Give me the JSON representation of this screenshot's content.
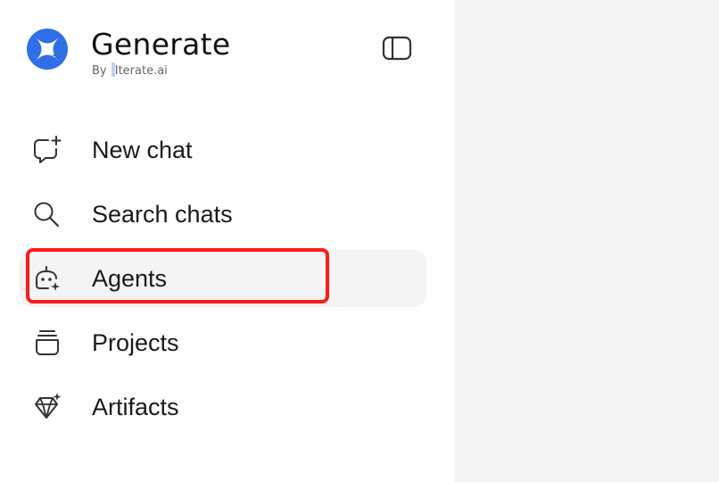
{
  "brand": {
    "title": "Generate",
    "subtitle_prefix": "By ",
    "subtitle_name": "Iterate.ai",
    "logo_icon": "sparkle-star-icon",
    "accent_color": "#2f6fe8"
  },
  "header": {
    "toggle_icon": "sidebar-toggle-icon"
  },
  "nav": {
    "items": [
      {
        "label": "New chat",
        "icon": "new-chat-icon",
        "active": false
      },
      {
        "label": "Search chats",
        "icon": "search-icon",
        "active": false
      },
      {
        "label": "Agents",
        "icon": "agent-bot-icon",
        "active": true
      },
      {
        "label": "Projects",
        "icon": "projects-stack-icon",
        "active": false
      },
      {
        "label": "Artifacts",
        "icon": "diamond-sparkle-icon",
        "active": false
      }
    ]
  },
  "annotation": {
    "highlight_color": "#ff1a1a",
    "highlight_target": "Agents"
  }
}
